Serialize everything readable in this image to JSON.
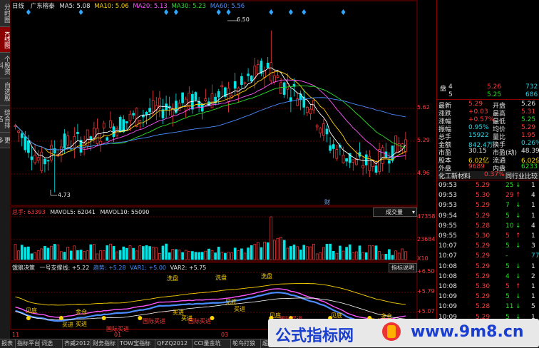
{
  "header": {
    "period": "日线",
    "stock_name": "广东榕泰",
    "ma5": "MA5: 5.08",
    "ma10": "MA10: 5.06",
    "ma20": "MA20: 5.13",
    "ma30": "MA30: 5.23",
    "ma60": "MA60: 5.56"
  },
  "sidebar": {
    "tabs": [
      "分时图",
      "K线图",
      "个股资料",
      "自选股",
      "综合排名",
      "更多"
    ]
  },
  "main_chart": {
    "high_label": "6.50",
    "low_label": "4.73",
    "axis": [
      "5.62",
      "5.29",
      "4.96"
    ],
    "marker": "财"
  },
  "volume": {
    "label": "总手: 63393",
    "mavol5": "MAVOL5: 62041",
    "mavol10": "MAVOL10: 55090",
    "dropdown": "成交量",
    "axis": [
      "47358",
      "23684",
      "X10"
    ]
  },
  "indicator": {
    "title": "饿狼决策",
    "line1": "一号支撑线: +5.22",
    "line2": "趋势: +5.28",
    "var1": "VAR1: +5.00",
    "var2": "VAR2: +5.75",
    "help": "指标说明",
    "axis": [
      "+6.50",
      "+5.79",
      "+5.07"
    ],
    "labels": [
      {
        "t": "洗盘",
        "c": "#ffd400"
      },
      {
        "t": "洗盘",
        "c": "#ffd400"
      },
      {
        "t": "洗盘",
        "c": "#ffd400"
      },
      {
        "t": "见底",
        "c": "#ffd400"
      },
      {
        "t": "金仓",
        "c": "#ffd400"
      },
      {
        "t": "见底",
        "c": "#ffd400"
      },
      {
        "t": "买进",
        "c": "#ffd400"
      },
      {
        "t": "国际买进",
        "c": "#ff3c3c"
      },
      {
        "t": "国际买进",
        "c": "#ff3c3c"
      },
      {
        "t": "买进",
        "c": "#ffd400"
      },
      {
        "t": "买进",
        "c": "#ffd400"
      },
      {
        "t": "国际买进",
        "c": "#ff3c3c"
      },
      {
        "t": "见底",
        "c": "#ffd400"
      },
      {
        "t": "买进",
        "c": "#ffd400"
      },
      {
        "t": "见底",
        "c": "#ffd400"
      },
      {
        "t": "国际买进",
        "c": "#ff3c3c"
      },
      {
        "t": "见底",
        "c": "#ffd400"
      },
      {
        "t": "买进",
        "c": "#ffd400"
      },
      {
        "t": "金仓",
        "c": "#ffd400"
      }
    ],
    "dates": [
      "11",
      "01",
      "03"
    ]
  },
  "order_book": {
    "rows": [
      {
        "label": "盘",
        "n": "4",
        "price": "5.26",
        "vol": "732"
      },
      {
        "label": "",
        "n": "5",
        "price": "5.25",
        "vol": "686"
      }
    ]
  },
  "quote": {
    "rows": [
      [
        {
          "t": "最新",
          "c": "white"
        },
        {
          "t": "5.29",
          "c": "red"
        },
        {
          "t": "开盘",
          "c": "white"
        },
        {
          "t": "5.26",
          "c": "white"
        }
      ],
      [
        {
          "t": "涨跌",
          "c": "white"
        },
        {
          "t": "+0.03",
          "c": "red"
        },
        {
          "t": "最高",
          "c": "white"
        },
        {
          "t": "5.31",
          "c": "red"
        }
      ],
      [
        {
          "t": "涨幅",
          "c": "white"
        },
        {
          "t": "+0.57%",
          "c": "red"
        },
        {
          "t": "最低",
          "c": "white"
        },
        {
          "t": "5.25",
          "c": "green"
        }
      ],
      [
        {
          "t": "振幅",
          "c": "white"
        },
        {
          "t": "0.95%",
          "c": "cyan"
        },
        {
          "t": "均价",
          "c": "white"
        },
        {
          "t": "5.29",
          "c": "red"
        }
      ],
      [
        {
          "t": "总手",
          "c": "white"
        },
        {
          "t": "15922",
          "c": "cyan"
        },
        {
          "t": "量比",
          "c": "white"
        },
        {
          "t": "1.95",
          "c": "red"
        }
      ],
      [
        {
          "t": "金额",
          "c": "white"
        },
        {
          "t": "842.4万",
          "c": "cyan"
        },
        {
          "t": "换手",
          "c": "white"
        },
        {
          "t": "0.26%",
          "c": "cyan"
        }
      ],
      [
        {
          "t": "市盈",
          "c": "white"
        },
        {
          "t": "30.15",
          "c": "white"
        },
        {
          "t": "市盈(动)",
          "c": "white"
        },
        {
          "t": "48.39",
          "c": "white"
        }
      ],
      [
        {
          "t": "股本",
          "c": "white"
        },
        {
          "t": "6.02亿",
          "c": "yellow"
        },
        {
          "t": "流通",
          "c": "white"
        },
        {
          "t": "6.02亿",
          "c": "yellow"
        }
      ],
      [
        {
          "t": "外盘",
          "c": "white"
        },
        {
          "t": "9689",
          "c": "red"
        },
        {
          "t": "内盘",
          "c": "white"
        },
        {
          "t": "6233",
          "c": "green"
        }
      ]
    ],
    "sector": "化工新材料",
    "sector_change": "0.37%",
    "sector_compare": "同行业比较"
  },
  "ticks": [
    {
      "time": "09:53",
      "price": "5.29",
      "vol": "25",
      "dir": "down",
      "ex": "1"
    },
    {
      "time": "09:53",
      "price": "5.30",
      "vol": "29",
      "dir": "up",
      "ex": "4"
    },
    {
      "time": "09:53",
      "price": "5.29",
      "vol": "7",
      "dir": "down",
      "ex": "1"
    },
    {
      "time": "09:54",
      "price": "5.29",
      "vol": "5",
      "dir": "down",
      "ex": "1"
    },
    {
      "time": "09:55",
      "price": "5.28",
      "vol": "10",
      "dir": "down",
      "ex": "4"
    },
    {
      "time": "09:55",
      "price": "5.30",
      "vol": "5",
      "dir": "up",
      "ex": "1"
    },
    {
      "time": "10:07",
      "price": "5.29",
      "vol": "5",
      "dir": "down",
      "ex": "3"
    },
    {
      "time": "10:07",
      "price": "5.29",
      "vol": "-",
      "dir": "none",
      "ex": "77"
    },
    {
      "time": "10:08",
      "price": "5.29",
      "vol": "5",
      "dir": "down",
      "ex": "1"
    },
    {
      "time": "10:08",
      "price": "5.29",
      "vol": "4",
      "dir": "down",
      "ex": "2"
    },
    {
      "time": "10:08",
      "price": "5.30",
      "vol": "5",
      "dir": "up",
      "ex": "1"
    },
    {
      "time": "10:09",
      "price": "5.29",
      "vol": "5",
      "dir": "down",
      "ex": "1"
    },
    {
      "time": "10:09",
      "price": "5.28",
      "vol": "11",
      "dir": "down",
      "ex": "5"
    },
    {
      "time": "10:09",
      "price": "5.29",
      "vol": "5",
      "dir": "down",
      "ex": "1"
    },
    {
      "time": "10:09",
      "price": "5.29",
      "vol": "16",
      "dir": "down",
      "ex": "2"
    }
  ],
  "bottom_tabs": [
    "报表",
    "指标平台",
    "词选",
    "齐威2012",
    "财务指标",
    "TOW宝指标",
    "QFZQ2012",
    "CCI量金坑",
    "鸵鸟打狼",
    "超级明"
  ],
  "watermark": {
    "left": "公式指标网",
    "right": "www.9m8.cn"
  },
  "colors": {
    "up": "#ff3c3c",
    "down": "#00e5e5",
    "ma5": "#ffffff",
    "ma10": "#ffd400",
    "ma20": "#ff55ff",
    "ma30": "#2adf2a",
    "ma60": "#4a8cff"
  }
}
